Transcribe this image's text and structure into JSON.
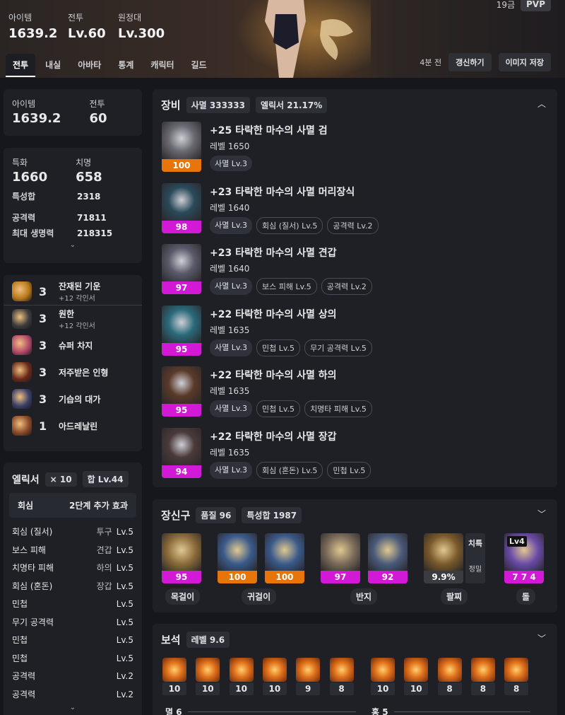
{
  "header": {
    "stats": [
      {
        "label": "아이템",
        "value": "1639.2"
      },
      {
        "label": "전투",
        "value": "Lv.60"
      },
      {
        "label": "원정대",
        "value": "Lv.300"
      }
    ],
    "age": "19금",
    "pvp": "PVP",
    "tabs": [
      "전투",
      "내실",
      "아바타",
      "통계",
      "캐릭터",
      "길드"
    ],
    "updated": "4분 전",
    "refresh": "갱신하기",
    "save_image": "이미지 저장"
  },
  "summary": {
    "item_label": "아이템",
    "item_value": "1639.2",
    "combat_label": "전투",
    "combat_value": "60"
  },
  "stats": {
    "spec_label": "특화",
    "spec_value": "1660",
    "crit_label": "치명",
    "crit_value": "658",
    "rows": [
      {
        "k": "특성합",
        "v": "2318"
      },
      {
        "k": "공격력",
        "v": "71811"
      },
      {
        "k": "최대 생명력",
        "v": "218315"
      }
    ]
  },
  "engravings": [
    {
      "lvl": "3",
      "name": "잔재된 기운",
      "sub": "+12 각인서",
      "color": "#b8791a"
    },
    {
      "lvl": "3",
      "name": "원한",
      "sub": "+12 각인서",
      "color": "#3b3b3b"
    },
    {
      "lvl": "3",
      "name": "슈퍼 차지",
      "sub": "",
      "color": "#b24a6a"
    },
    {
      "lvl": "3",
      "name": "저주받은 인형",
      "sub": "",
      "color": "#6a2a1a"
    },
    {
      "lvl": "3",
      "name": "기습의 대가",
      "sub": "",
      "color": "#3a3f6a"
    },
    {
      "lvl": "1",
      "name": "아드레날린",
      "sub": "",
      "color": "#8a4a2a"
    }
  ],
  "elixir": {
    "title": "엘릭서",
    "count": "× 10",
    "sum": "합 Lv.44",
    "bonus_name": "회심",
    "bonus_desc": "2단계 추가 효과",
    "rows": [
      {
        "name": "회심 (질서)",
        "slot": "투구",
        "lv": "Lv.5"
      },
      {
        "name": "보스 피해",
        "slot": "견갑",
        "lv": "Lv.5"
      },
      {
        "name": "치명타 피해",
        "slot": "하의",
        "lv": "Lv.5"
      },
      {
        "name": "회심 (혼돈)",
        "slot": "장갑",
        "lv": "Lv.5"
      },
      {
        "name": "민첩",
        "slot": "",
        "lv": "Lv.5"
      },
      {
        "name": "무기 공격력",
        "slot": "",
        "lv": "Lv.5"
      },
      {
        "name": "민첩",
        "slot": "",
        "lv": "Lv.5"
      },
      {
        "name": "민첩",
        "slot": "",
        "lv": "Lv.5"
      },
      {
        "name": "공격력",
        "slot": "",
        "lv": "Lv.2"
      },
      {
        "name": "공격력",
        "slot": "",
        "lv": "Lv.2"
      }
    ]
  },
  "equipment": {
    "title": "장비",
    "chip1": "사멸 333333",
    "chip2": "엘릭서 21.17%",
    "items": [
      {
        "name": "+25 타락한 마수의 사멸 검",
        "level": "레벨 1650",
        "quality": "100",
        "qcolor": "#e8750a",
        "tags": [
          "사멸 Lv.3"
        ]
      },
      {
        "name": "+23 타락한 마수의 사멸 머리장식",
        "level": "레벨 1640",
        "quality": "98",
        "qcolor": "#d21ad6",
        "tags": [
          "사멸 Lv.3",
          "회심 (질서) Lv.5",
          "공격력 Lv.2"
        ]
      },
      {
        "name": "+23 타락한 마수의 사멸 견갑",
        "level": "레벨 1640",
        "quality": "97",
        "qcolor": "#d21ad6",
        "tags": [
          "사멸 Lv.3",
          "보스 피해 Lv.5",
          "공격력 Lv.2"
        ]
      },
      {
        "name": "+22 타락한 마수의 사멸 상의",
        "level": "레벨 1635",
        "quality": "95",
        "qcolor": "#d21ad6",
        "tags": [
          "사멸 Lv.3",
          "민첩 Lv.5",
          "무기 공격력 Lv.5"
        ]
      },
      {
        "name": "+22 타락한 마수의 사멸 하의",
        "level": "레벨 1635",
        "quality": "95",
        "qcolor": "#d21ad6",
        "tags": [
          "사멸 Lv.3",
          "민첩 Lv.5",
          "치명타 피해 Lv.5"
        ]
      },
      {
        "name": "+22 타락한 마수의 사멸 장갑",
        "level": "레벨 1635",
        "quality": "94",
        "qcolor": "#d21ad6",
        "tags": [
          "사멸 Lv.3",
          "회심 (혼돈) Lv.5",
          "민첩 Lv.5"
        ]
      }
    ]
  },
  "accessories": {
    "title": "장신구",
    "chip1": "품질 96",
    "chip2": "특성합 1987",
    "items": [
      {
        "q": "95",
        "qcolor": "#d21ad6",
        "pic": "#8a6a3a"
      },
      {
        "q": "100",
        "qcolor": "#e8750a",
        "pic": "#3a5a8a"
      },
      {
        "q": "100",
        "qcolor": "#e8750a",
        "pic": "#3a5a8a"
      },
      {
        "q": "97",
        "qcolor": "#d21ad6",
        "pic": "#7a6a5a"
      },
      {
        "q": "92",
        "qcolor": "#d21ad6",
        "pic": "#4a5a7a"
      },
      {
        "q": "9.9%",
        "qcolor": "#3a3c42",
        "pic": "#7a5a2a"
      },
      {
        "q": "7 7 4",
        "qcolor": "#d21ad6",
        "pic": "#6a4aa8"
      }
    ],
    "bracelet_side": [
      "치특",
      "정밀"
    ],
    "stone_lv": "Lv4",
    "labels": [
      "목걸이",
      "귀걸이",
      "반지",
      "팔찌",
      "돌"
    ]
  },
  "gems": {
    "title": "보석",
    "chip": "레벨 9.6",
    "left": [
      "10",
      "10",
      "10",
      "10",
      "9",
      "8"
    ],
    "right": [
      "10",
      "10",
      "8",
      "8",
      "8"
    ],
    "left_label": "멸 6",
    "right_label": "홍 5"
  }
}
